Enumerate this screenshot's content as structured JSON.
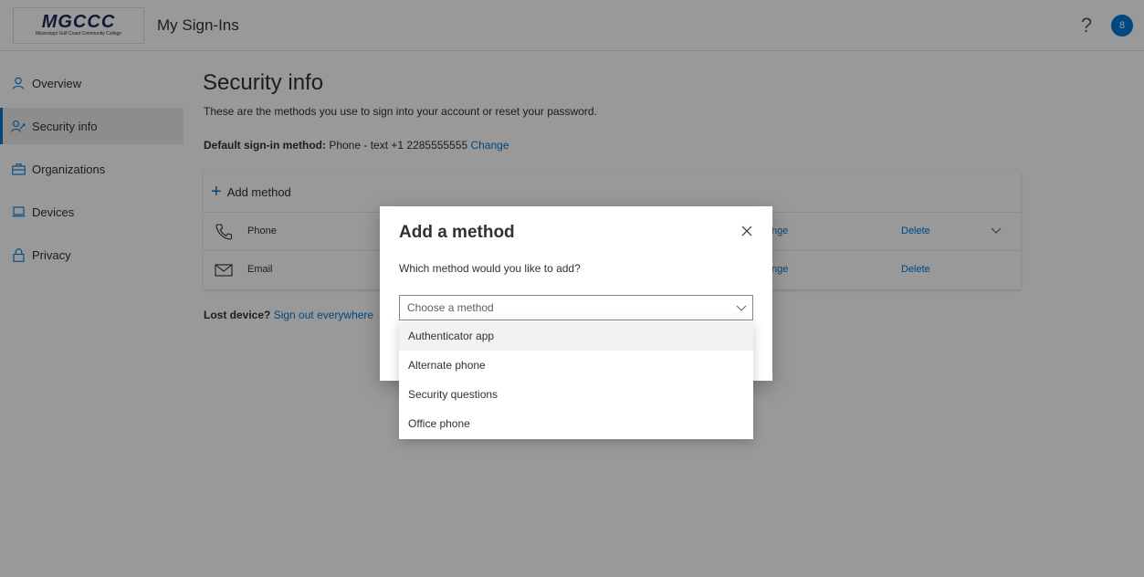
{
  "header": {
    "logo_main": "MGCCC",
    "logo_sub": "Mississippi Gulf Coast Community College",
    "app_title": "My Sign-Ins",
    "help_icon": "?",
    "avatar_initial": "8"
  },
  "sidebar": {
    "items": [
      {
        "label": "Overview",
        "icon": "person-icon"
      },
      {
        "label": "Security info",
        "icon": "security-info-icon",
        "active": true
      },
      {
        "label": "Organizations",
        "icon": "briefcase-icon"
      },
      {
        "label": "Devices",
        "icon": "laptop-icon"
      },
      {
        "label": "Privacy",
        "icon": "lock-icon"
      }
    ]
  },
  "main": {
    "title": "Security info",
    "description": "These are the methods you use to sign into your account or reset your password.",
    "default_label": "Default sign-in method:",
    "default_value": " Phone - text +1 2285555555 ",
    "default_change": "Change",
    "add_method": "Add method",
    "methods": [
      {
        "name": "Phone",
        "change": "nge",
        "delete": "Delete",
        "icon": "phone-icon"
      },
      {
        "name": "Email",
        "change": "nge",
        "delete": "Delete",
        "icon": "mail-icon"
      }
    ],
    "lost_label": "Lost device?",
    "lost_link": "Sign out everywhere"
  },
  "dialog": {
    "title": "Add a method",
    "question": "Which method would you like to add?",
    "select_placeholder": "Choose a method",
    "options": [
      "Authenticator app",
      "Alternate phone",
      "Security questions",
      "Office phone"
    ]
  },
  "colors": {
    "accent": "#0078d4",
    "overlay": "rgba(0,0,0,0.4)"
  }
}
